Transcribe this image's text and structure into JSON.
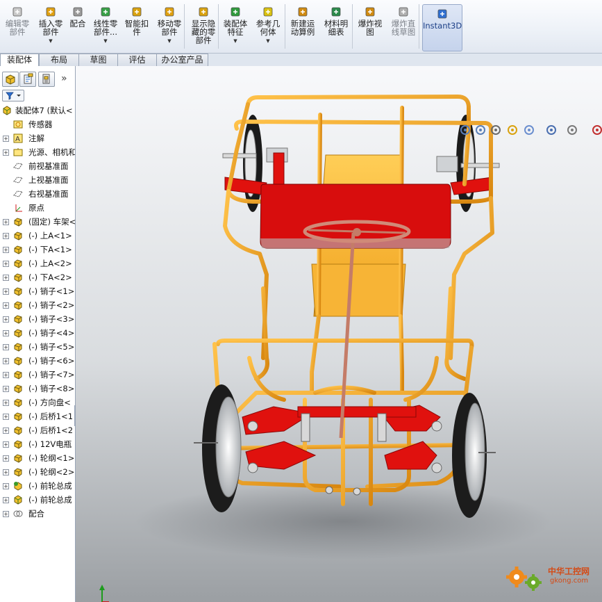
{
  "ribbon": {
    "buttons": [
      {
        "label": "编辑零\n部件",
        "icon": "edit-component-icon",
        "dim": true
      },
      {
        "label": "插入零\n部件",
        "icon": "insert-component-icon",
        "dropdown": true
      },
      {
        "label": "配合",
        "icon": "mate-paperclip-icon"
      },
      {
        "label": "线性零\n部件...",
        "icon": "linear-pattern-icon",
        "dropdown": true
      },
      {
        "label": "智能扣\n件",
        "icon": "smart-fastener-icon"
      },
      {
        "label": "移动零\n部件",
        "icon": "move-component-icon",
        "dropdown": true
      },
      {
        "label": "显示隐\n藏的零\n部件",
        "icon": "show-hidden-components-icon"
      },
      {
        "label": "装配体\n特征",
        "icon": "assembly-feature-icon",
        "dropdown": true
      },
      {
        "label": "参考几\n何体",
        "icon": "reference-geometry-icon",
        "dropdown": true
      },
      {
        "label": "新建运\n动算例",
        "icon": "new-motion-study-icon"
      },
      {
        "label": "材料明\n细表",
        "icon": "bill-of-materials-icon"
      },
      {
        "label": "爆炸视\n图",
        "icon": "exploded-view-icon"
      },
      {
        "label": "爆炸直\n线草图",
        "icon": "explode-line-sketch-icon",
        "dim": true
      },
      {
        "label": "Instant3D",
        "icon": "instant3d-icon"
      }
    ]
  },
  "tabs": [
    "装配体",
    "布局",
    "草图",
    "评估",
    "办公室产品"
  ],
  "active_tab": "装配体",
  "panel_tabs": [
    "feature-manager-icon",
    "property-manager-icon",
    "configuration-manager-icon"
  ],
  "tree": {
    "root": "装配体7  (默认<",
    "items": [
      {
        "label": "传感器",
        "icon": "sensor-icon",
        "expander": false
      },
      {
        "label": "注解",
        "icon": "annotation-icon",
        "expander": true
      },
      {
        "label": "光源、相机和",
        "icon": "lights-cameras-icon",
        "expander": true
      },
      {
        "label": "前视基准面",
        "icon": "plane-icon",
        "expander": false
      },
      {
        "label": "上视基准面",
        "icon": "plane-icon",
        "expander": false
      },
      {
        "label": "右视基准面",
        "icon": "plane-icon",
        "expander": false
      },
      {
        "label": "原点",
        "icon": "origin-icon",
        "expander": false
      },
      {
        "label": "(固定) 车架<",
        "icon": "part-icon",
        "expander": true
      },
      {
        "label": "(-) 上A<1>",
        "icon": "part-icon",
        "expander": true
      },
      {
        "label": "(-) 下A<1>",
        "icon": "part-icon",
        "expander": true
      },
      {
        "label": "(-) 上A<2>",
        "icon": "part-icon",
        "expander": true
      },
      {
        "label": "(-) 下A<2>",
        "icon": "part-icon",
        "expander": true
      },
      {
        "label": "(-) 销子<1>",
        "icon": "part-icon",
        "expander": true
      },
      {
        "label": "(-) 销子<2>",
        "icon": "part-icon",
        "expander": true
      },
      {
        "label": "(-) 销子<3>",
        "icon": "part-icon",
        "expander": true
      },
      {
        "label": "(-) 销子<4>",
        "icon": "part-icon",
        "expander": true
      },
      {
        "label": "(-) 销子<5>",
        "icon": "part-icon",
        "expander": true
      },
      {
        "label": "(-) 销子<6>",
        "icon": "part-icon",
        "expander": true
      },
      {
        "label": "(-) 销子<7>",
        "icon": "part-icon",
        "expander": true
      },
      {
        "label": "(-) 销子<8>",
        "icon": "part-icon",
        "expander": true
      },
      {
        "label": "(-) 方向盘<",
        "icon": "part-icon",
        "expander": true
      },
      {
        "label": "(-) 后桥1<1",
        "icon": "part-icon",
        "expander": true
      },
      {
        "label": "(-) 后桥1<2",
        "icon": "part-icon",
        "expander": true
      },
      {
        "label": "(-) 12V电瓶",
        "icon": "part-icon",
        "expander": true
      },
      {
        "label": "(-) 轮纲<1>",
        "icon": "part-icon",
        "expander": true
      },
      {
        "label": "(-) 轮纲<2>",
        "icon": "part-icon",
        "expander": true
      },
      {
        "label": "(-) 前轮总成",
        "icon": "subassembly-icon",
        "expander": true
      },
      {
        "label": "(-) 前轮总成",
        "icon": "assembly-icon",
        "expander": true
      },
      {
        "label": "配合",
        "icon": "mates-icon",
        "expander": true
      }
    ]
  },
  "viewport": {
    "toolbar": [
      "zoom-to-fit-icon",
      "zoom-area-icon",
      "previous-view-icon",
      "section-view-icon",
      "view-orientation-icon",
      "display-style-icon",
      "hide-show-items-icon",
      "edit-appearance-icon",
      "apply-scene-icon",
      "view-settings-icon"
    ]
  },
  "watermark": {
    "name": "中华工控网",
    "url": "gkong.com"
  },
  "colors": {
    "frame": "#f0a11f",
    "red_parts": "#e0110e",
    "seat": "#d80d0d",
    "steering": "#d08a78",
    "ribbon_accent": "#1c3f86"
  }
}
